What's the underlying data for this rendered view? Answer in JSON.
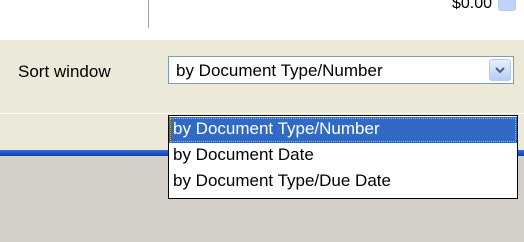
{
  "top_row": {
    "amount_text": "$0.00"
  },
  "sort": {
    "label": "Sort window",
    "selected_value": "by Document Type/Number",
    "options": [
      "by Document Type/Number",
      "by Document Date",
      "by Document Type/Due Date"
    ],
    "selected_index": 0
  },
  "colors": {
    "selection_bg": "#316ac5",
    "accent_bar": "#0b3fb5",
    "panel_bg": "#ece9d8"
  },
  "icons": {
    "combo_button": "chevron-down-icon"
  }
}
